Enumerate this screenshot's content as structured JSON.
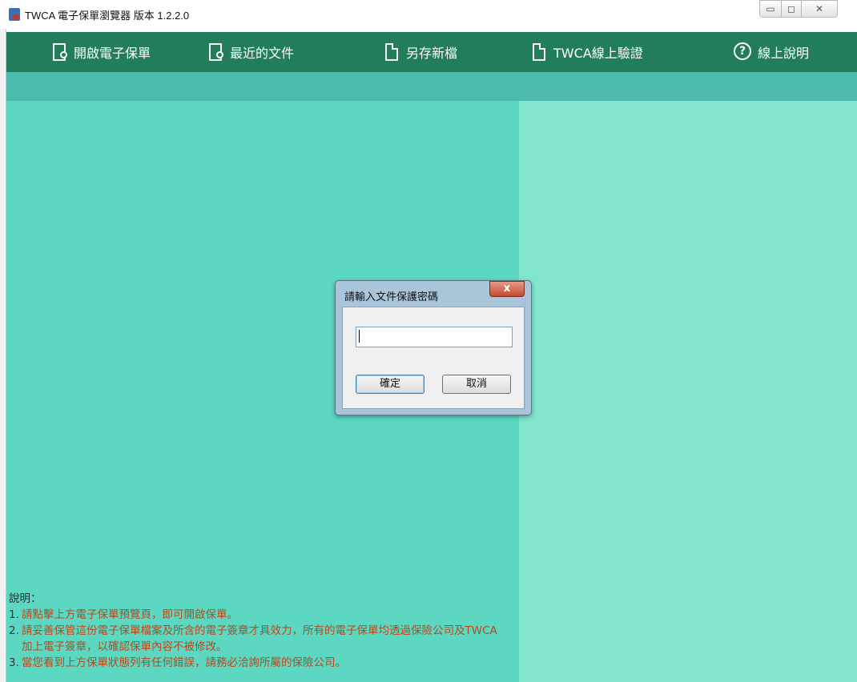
{
  "window": {
    "title": "TWCA 電子保單瀏覽器 版本 1.2.2.0",
    "controls": {
      "minimize": "▭",
      "maximize": "◻",
      "close": "✕"
    }
  },
  "toolbar": {
    "items": [
      {
        "label": "開啟電子保單",
        "icon": "open-document-icon"
      },
      {
        "label": "最近的文件",
        "icon": "recent-document-icon"
      },
      {
        "label": "另存新檔",
        "icon": "save-as-icon"
      },
      {
        "label": "TWCA線上驗證",
        "icon": "online-verify-icon"
      },
      {
        "label": "線上說明",
        "icon": "help-icon"
      }
    ]
  },
  "colors": {
    "toolbar": "#217d5a",
    "subbar": "#4cbaad",
    "left_panel": "#5cd8c2",
    "right_panel": "#82e6cf",
    "note_text": "#b44a1e"
  },
  "notes": {
    "heading": "說明：",
    "items": [
      {
        "num": "1.",
        "text": "請點擊上方電子保單預覽頁，即可開啟保單。"
      },
      {
        "num": "2.",
        "text": "請妥善保管這份電子保單檔案及所含的電子簽章才具效力，所有的電子保單均透過保險公司及TWCA加上電子簽章，以確認保單內容不被修改。"
      },
      {
        "num": "3.",
        "text": "當您看到上方保單狀態列有任何錯誤，請務必洽詢所屬的保險公司。"
      }
    ]
  },
  "dialog": {
    "title": "請輸入文件保護密碼",
    "close_label": "x",
    "password_value": "",
    "ok_label": "確定",
    "cancel_label": "取消"
  }
}
